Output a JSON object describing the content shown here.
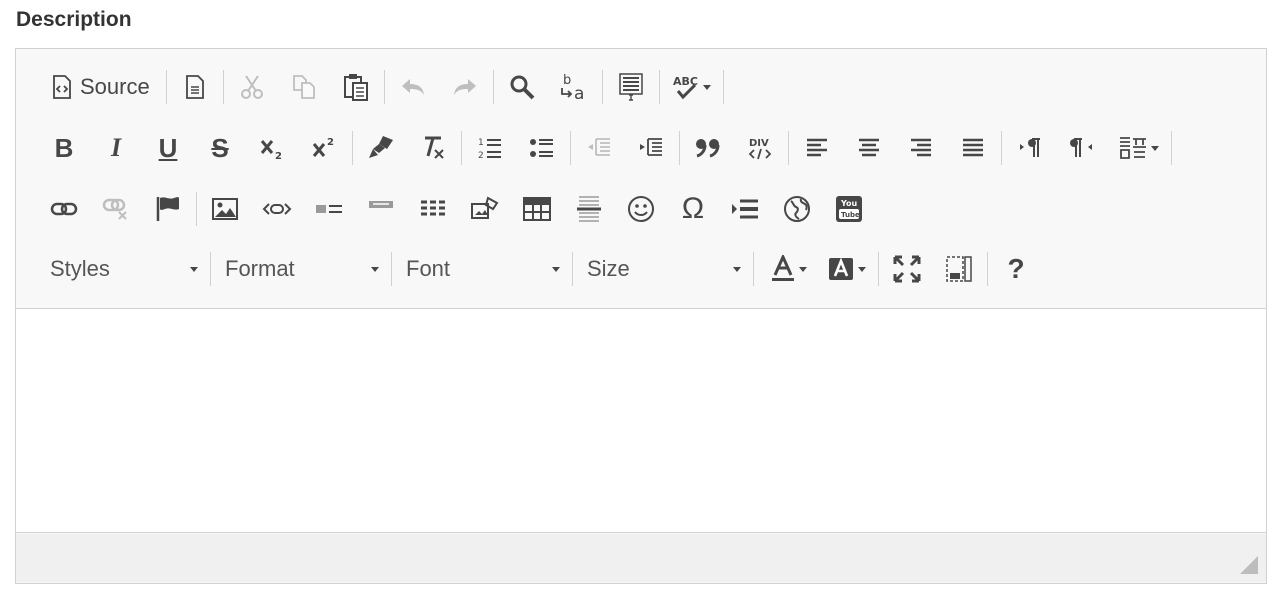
{
  "field": {
    "label": "Description"
  },
  "toolbar": {
    "source_label": "Source",
    "bold": "B",
    "italic": "I",
    "underline": "U",
    "strike": "S",
    "omega": "Ω",
    "help": "?",
    "combos": {
      "styles": "Styles",
      "format": "Format",
      "font": "Font",
      "size": "Size"
    }
  },
  "colors": {
    "icon": "#474747",
    "toolbar_bg": "#f8f8f8",
    "border": "#d1d1d1",
    "bottom_bg": "#f0f0f0"
  }
}
